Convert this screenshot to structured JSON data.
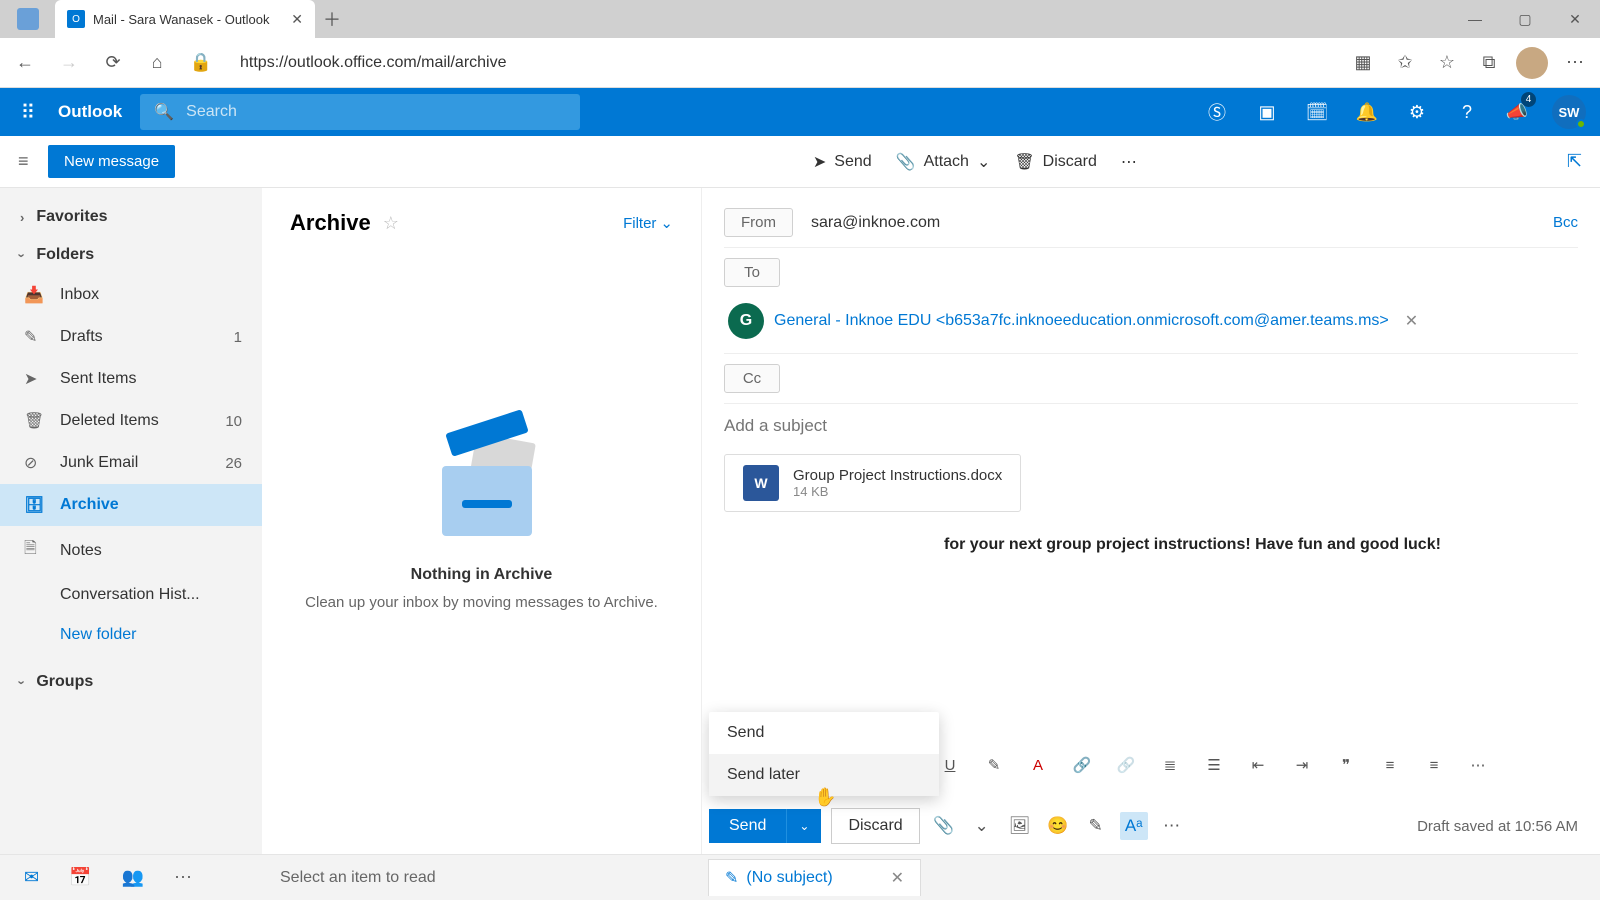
{
  "browser": {
    "tab_title": "Mail - Sara Wanasek - Outlook",
    "url": "https://outlook.office.com/mail/archive"
  },
  "owa_header": {
    "brand": "Outlook",
    "search_placeholder": "Search",
    "notification_badge": "4",
    "avatar_initials": "SW"
  },
  "action_bar": {
    "new_message": "New message",
    "send": "Send",
    "attach": "Attach",
    "discard": "Discard"
  },
  "sidebar": {
    "favorites": "Favorites",
    "folders": "Folders",
    "items": {
      "inbox": {
        "label": "Inbox"
      },
      "drafts": {
        "label": "Drafts",
        "count": "1"
      },
      "sent": {
        "label": "Sent Items"
      },
      "deleted": {
        "label": "Deleted Items",
        "count": "10"
      },
      "junk": {
        "label": "Junk Email",
        "count": "26"
      },
      "archive": {
        "label": "Archive"
      },
      "notes": {
        "label": "Notes"
      },
      "convhist": {
        "label": "Conversation Hist..."
      }
    },
    "new_folder": "New folder",
    "groups": "Groups"
  },
  "list_pane": {
    "title": "Archive",
    "filter": "Filter",
    "empty_title": "Nothing in Archive",
    "empty_sub": "Clean up your inbox by moving messages to Archive."
  },
  "compose": {
    "from_label": "From",
    "from_value": "sara@inknoe.com",
    "bcc": "Bcc",
    "to_label": "To",
    "cc_label": "Cc",
    "recipient": {
      "initial": "G",
      "text": "General - Inknoe EDU <b653a7fc.inknoeeducation.onmicrosoft.com@amer.teams.ms>"
    },
    "subject_placeholder": "Add a subject",
    "attachment": {
      "name": "Group Project Instructions.docx",
      "size": "14 KB",
      "icon_letter": "W"
    },
    "body_fragment": "for your next group project instructions! Have fun and good luck!",
    "send_menu": {
      "send": "Send",
      "send_later": "Send later"
    },
    "send_button": "Send",
    "discard_button": "Discard",
    "draft_status": "Draft saved at 10:56 AM"
  },
  "bottom": {
    "reading_hint": "Select an item to read",
    "compose_tab_title": "(No subject)"
  }
}
